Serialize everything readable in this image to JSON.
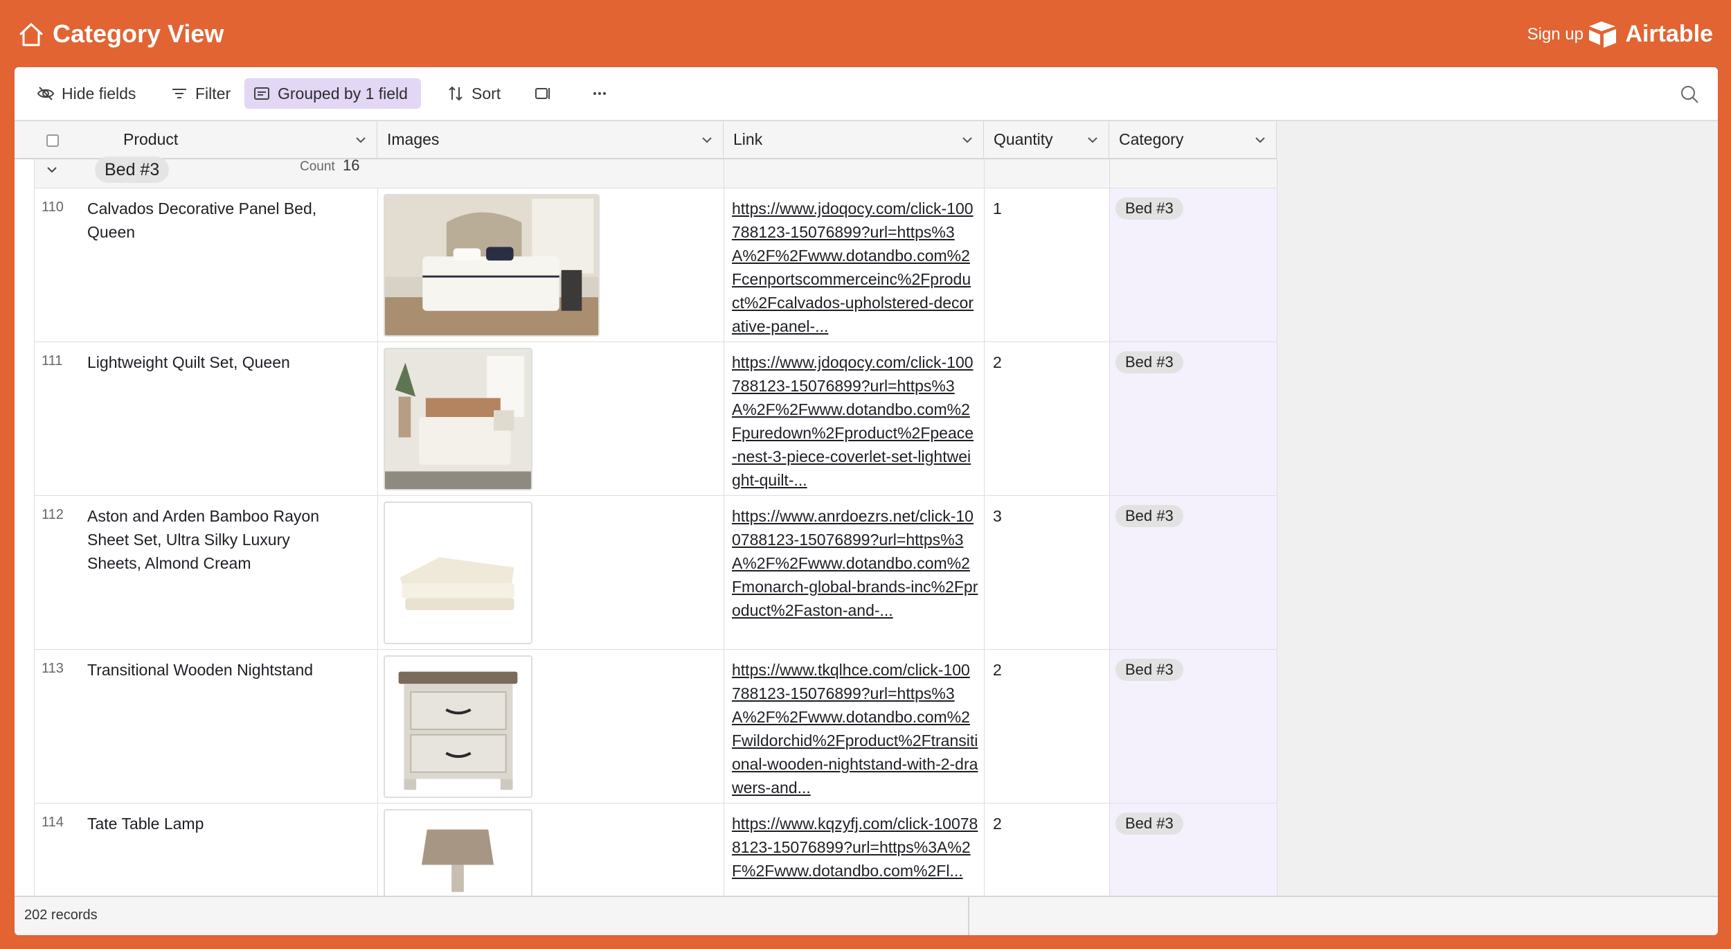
{
  "header": {
    "title": "Category View",
    "signup_label": "Sign up",
    "brand_name": "Airtable"
  },
  "toolbar": {
    "hide_fields": "Hide fields",
    "filter": "Filter",
    "grouped": "Grouped by 1 field",
    "sort": "Sort"
  },
  "columns": {
    "product": "Product",
    "images": "Images",
    "link": "Link",
    "quantity": "Quantity",
    "category": "Category"
  },
  "group": {
    "name": "Bed #3",
    "count_label": "Count",
    "count_value": "16"
  },
  "rows": [
    {
      "num": "110",
      "product": "Calvados Decorative Panel Bed, Queen",
      "image_icon": "bed-photo",
      "link": "https://www.jdoqocy.com/click-100788123-15076899?url=https%3A%2F%2Fwww.dotandbo.com%2Fcenportscommerceinc%2Fproduct%2Fcalvados-upholstered-decorative-panel-...",
      "quantity": "1",
      "category": "Bed #3"
    },
    {
      "num": "111",
      "product": "Lightweight Quilt Set, Queen",
      "image_icon": "quilt-bed-photo",
      "link": "https://www.jdoqocy.com/click-100788123-15076899?url=https%3A%2F%2Fwww.dotandbo.com%2Fpuredown%2Fproduct%2Fpeace-nest-3-piece-coverlet-set-lightweight-quilt-...",
      "quantity": "2",
      "category": "Bed #3"
    },
    {
      "num": "112",
      "product": "Aston and Arden Bamboo Rayon Sheet Set, Ultra Silky Luxury Sheets, Almond Cream",
      "image_icon": "sheets-photo",
      "link": "https://www.anrdoezrs.net/click-100788123-15076899?url=https%3A%2F%2Fwww.dotandbo.com%2Fmonarch-global-brands-inc%2Fproduct%2Faston-and-...",
      "quantity": "3",
      "category": "Bed #3"
    },
    {
      "num": "113",
      "product": "Transitional Wooden Nightstand",
      "image_icon": "nightstand-photo",
      "link": "https://www.tkqlhce.com/click-100788123-15076899?url=https%3A%2F%2Fwww.dotandbo.com%2Fwildorchid%2Fproduct%2Ftransitional-wooden-nightstand-with-2-drawers-and...",
      "quantity": "2",
      "category": "Bed #3"
    },
    {
      "num": "114",
      "product": "Tate Table Lamp",
      "image_icon": "lamp-photo",
      "link": "https://www.kqzyfj.com/click-100788123-15076899?url=https%3A%2F%2Fwww.dotandbo.com%2Fl...",
      "quantity": "2",
      "category": "Bed #3"
    }
  ],
  "footer": {
    "records": "202 records"
  },
  "colors": {
    "brand_orange": "#e16432",
    "group_toolbar_active": "#e2d7f5",
    "category_column_bg": "#f4f1fd"
  }
}
